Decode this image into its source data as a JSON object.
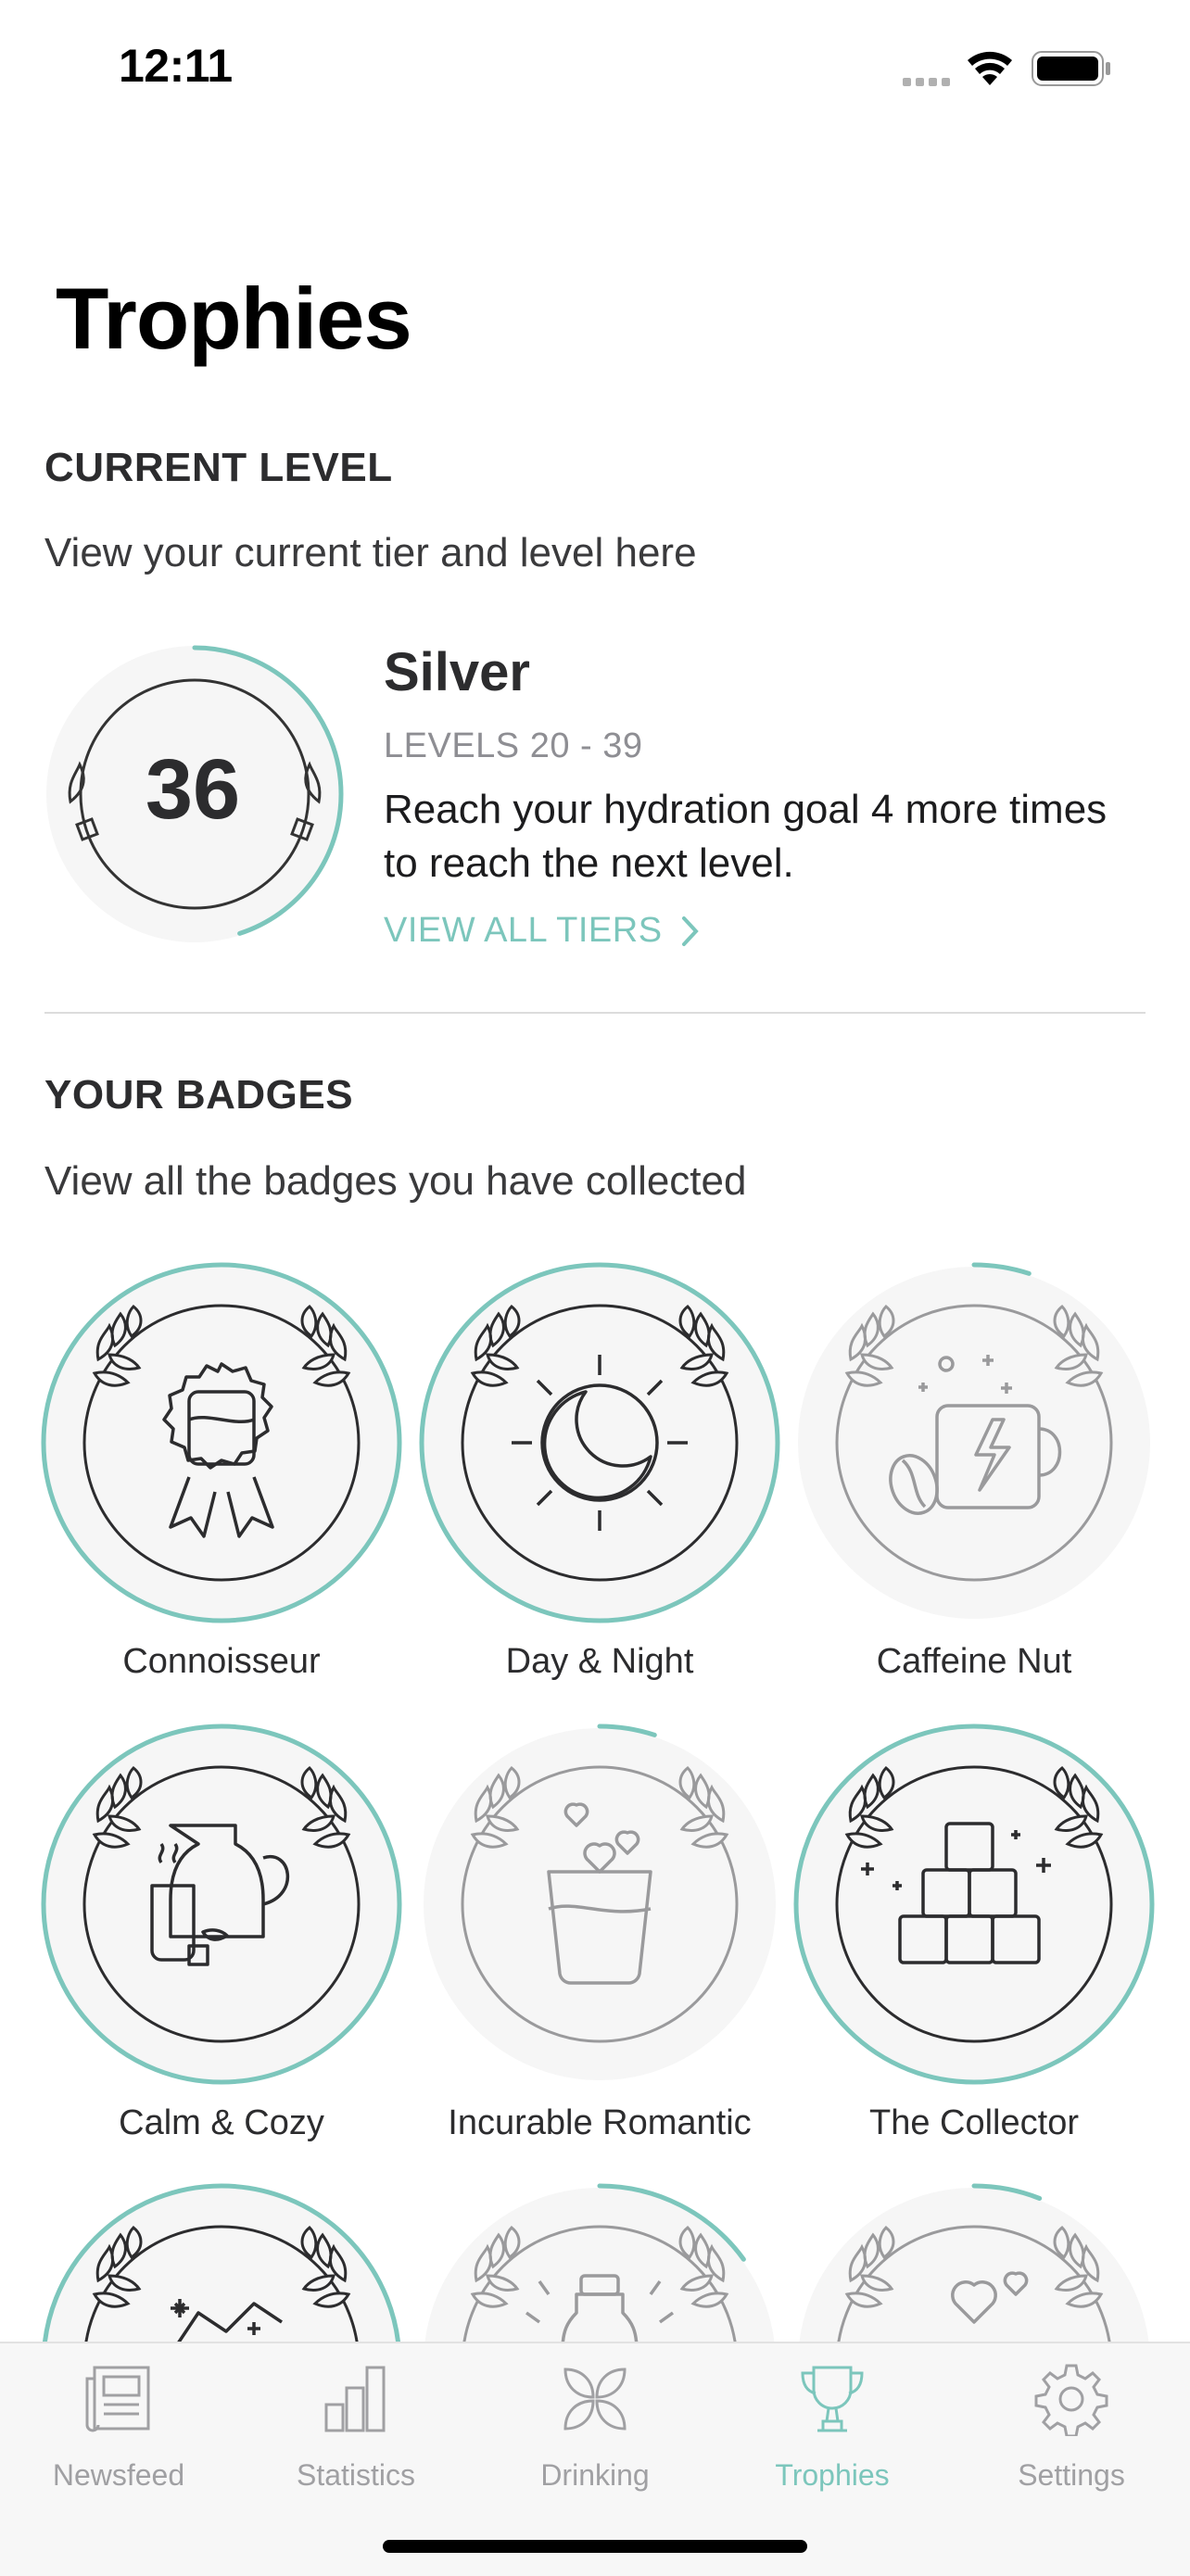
{
  "status": {
    "time": "12:11"
  },
  "page": {
    "title": "Trophies"
  },
  "current_level": {
    "heading": "CURRENT LEVEL",
    "subtitle": "View your current tier and level here",
    "level": "36",
    "progress_fraction": 0.45,
    "tier": "Silver",
    "levels_range": "LEVELS 20 - 39",
    "description": "Reach your hydration goal 4 more times to reach the next level.",
    "link": "VIEW ALL TIERS"
  },
  "badges": {
    "heading": "YOUR BADGES",
    "subtitle": "View all the badges you have collected",
    "items": [
      {
        "label": "Connoisseur",
        "icon": "ribbon-glass-icon",
        "earned": true,
        "progress": 1
      },
      {
        "label": "Day & Night",
        "icon": "sun-moon-icon",
        "earned": true,
        "progress": 1
      },
      {
        "label": "Caffeine Nut",
        "icon": "coffee-mug-icon",
        "earned": false,
        "progress": 0.05
      },
      {
        "label": "Calm & Cozy",
        "icon": "teapot-icon",
        "earned": true,
        "progress": 1
      },
      {
        "label": "Incurable Romantic",
        "icon": "heart-glass-icon",
        "earned": false,
        "progress": 0.05
      },
      {
        "label": "The Collector",
        "icon": "ice-cubes-icon",
        "earned": true,
        "progress": 1
      },
      {
        "label": "",
        "icon": "snow-mountain-icon",
        "earned": true,
        "progress": 1
      },
      {
        "label": "",
        "icon": "bottle-icon",
        "earned": false,
        "progress": 0.15
      },
      {
        "label": "",
        "icon": "hearts-icon",
        "earned": false,
        "progress": 0.06
      }
    ]
  },
  "tabbar": {
    "tabs": [
      {
        "label": "Newsfeed",
        "icon": "newspaper-icon",
        "active": false
      },
      {
        "label": "Statistics",
        "icon": "bar-chart-icon",
        "active": false
      },
      {
        "label": "Drinking",
        "icon": "petals-icon",
        "active": false
      },
      {
        "label": "Trophies",
        "icon": "trophy-icon",
        "active": true
      },
      {
        "label": "Settings",
        "icon": "gear-icon",
        "active": false
      }
    ]
  },
  "colors": {
    "accent": "#7cc6bc",
    "text": "#2c2c2e",
    "inactive": "#a0a0a3",
    "badge_bg": "#f6f6f6"
  }
}
